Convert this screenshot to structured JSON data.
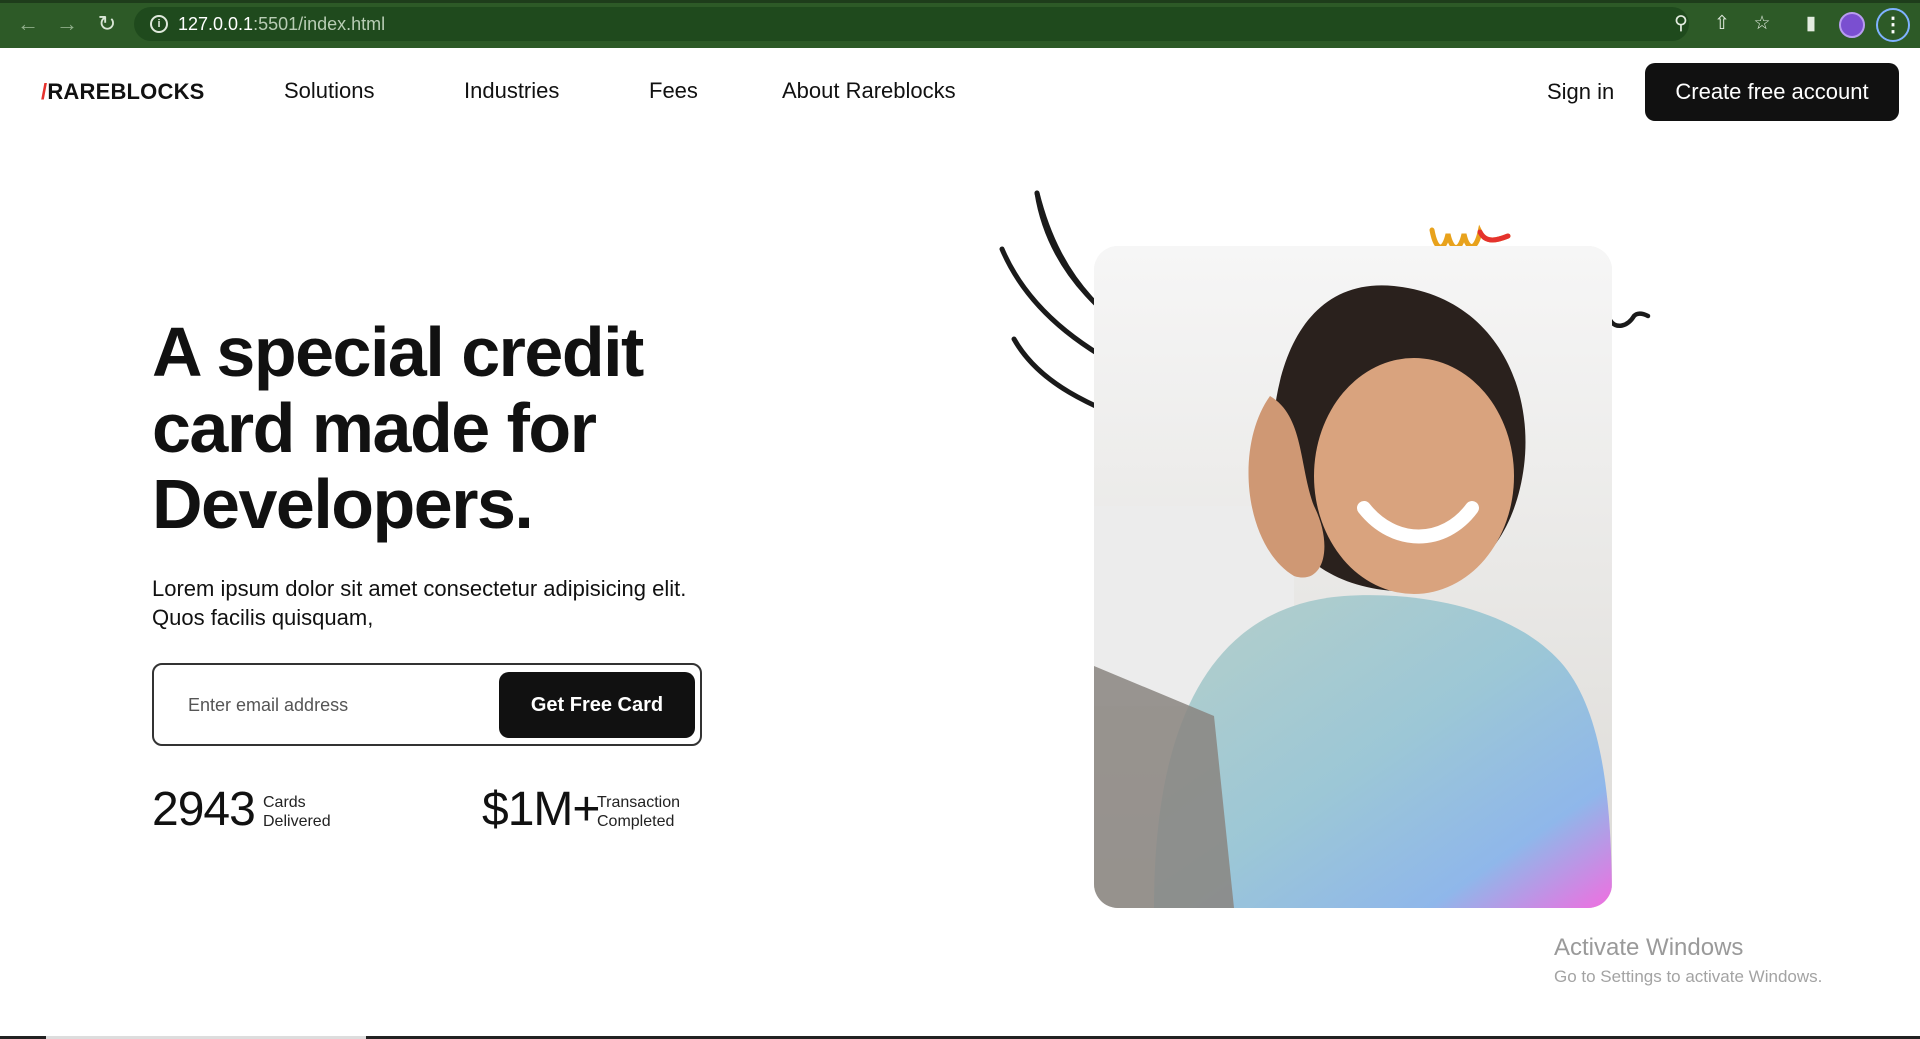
{
  "browser": {
    "url_host": "127.0.0.1",
    "url_path": ":5501/index.html"
  },
  "header": {
    "logo_slash": "/",
    "logo_text": "RAREBLOCKS",
    "nav": [
      "Solutions",
      "Industries",
      "Fees",
      "About Rareblocks"
    ],
    "signin_label": "Sign in",
    "cta_label": "Create free account"
  },
  "hero": {
    "title_line1": "A special credit",
    "title_line2": "card made for",
    "title_line3": "Developers.",
    "subtitle": "Lorem ipsum dolor sit amet consectetur adipisicing elit. Quos facilis quisquam,",
    "email_placeholder": "Enter email address",
    "button_label": "Get Free Card"
  },
  "stats": [
    {
      "value": "2943",
      "label1": "Cards",
      "label2": "Delivered"
    },
    {
      "value": "$1M+",
      "label1": "Transaction",
      "label2": "Completed"
    }
  ],
  "watermark": {
    "title": "Activate Windows",
    "subtitle": "Go to Settings to activate Windows."
  },
  "colors": {
    "accent": "#e5322d",
    "dark": "#111111",
    "browser_bar": "#2d5a27"
  }
}
